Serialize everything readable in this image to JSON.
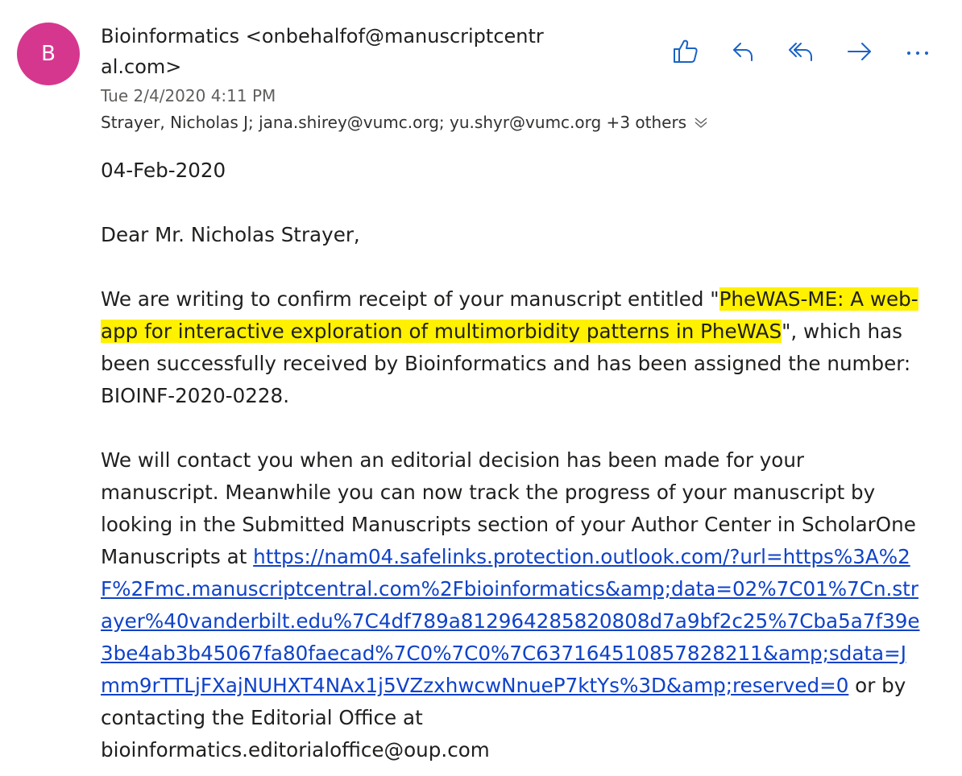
{
  "avatar": {
    "initial": "B",
    "color": "#d5378f"
  },
  "header": {
    "sender": "Bioinformatics <onbehalfof@manuscriptcentral.com>",
    "datetime": "Tue 2/4/2020 4:11 PM",
    "recipients": "Strayer, Nicholas J; jana.shirey@vumc.org; yu.shyr@vumc.org +3 others"
  },
  "toolbar": {
    "icons": [
      "like-icon",
      "reply-icon",
      "reply-all-icon",
      "forward-icon",
      "more-icon"
    ],
    "accent": "#1a63c4"
  },
  "body": {
    "date_line": "04-Feb-2020",
    "greeting": "Dear Mr. Nicholas Strayer,",
    "p1_before": "We are writing to confirm receipt of your manuscript entitled \"",
    "p1_title": "PheWAS-ME: A web-app for interactive exploration of multimorbidity patterns in PheWAS",
    "p1_after": "\", which has been successfully received by Bioinformatics and has been assigned the number: BIOINF-2020-0228.",
    "p2_before": "We will contact you when an editorial decision has been made for your manuscript. Meanwhile you can now track the progress of your manuscript by looking in the Submitted Manuscripts section of your Author Center in ScholarOne Manuscripts at ",
    "p2_link": "https://nam04.safelinks.protection.outlook.com/?url=https%3A%2F%2Fmc.manuscriptcentral.com%2Fbioinformatics&amp;data=02%7C01%7Cn.strayer%40vanderbilt.edu%7C4df789a812964285820808d7a9bf2c25%7Cba5a7f39e3be4ab3b45067fa80faecad%7C0%7C0%7C637164510857828211&amp;sdata=Jmm9rTTLjFXajNUHXT4NAx1j5VZzxhwcwNnueP7ktYs%3D&amp;reserved=0",
    "p2_after": " or by contacting the Editorial Office at",
    "p2_email": "bioinformatics.editorialoffice@oup.com",
    "highlight_color": "#fff100",
    "link_color": "#0f42c9"
  }
}
